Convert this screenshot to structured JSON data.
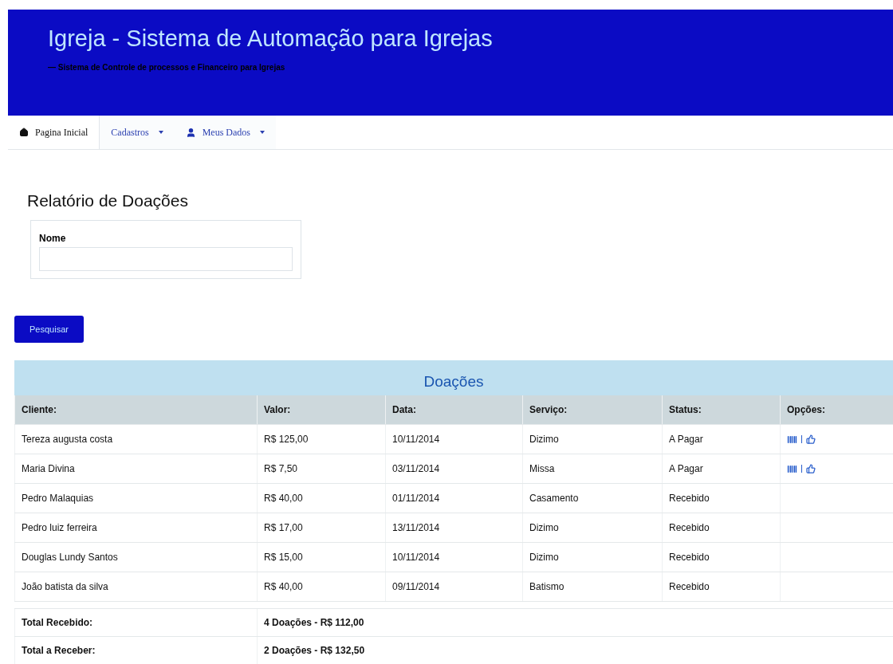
{
  "header": {
    "title": "Igreja - Sistema de Automação para Igrejas",
    "subtitle": "— Sistema de Controle de processos e Financeiro para Igrejas"
  },
  "nav": [
    {
      "label": "Pagina  Inicial",
      "kind": "home",
      "dropdown": false,
      "selected": true
    },
    {
      "label": "Cadastros",
      "kind": "plain",
      "dropdown": true,
      "selected": false
    },
    {
      "label": "Meus  Dados",
      "kind": "user",
      "dropdown": true,
      "selected": false
    }
  ],
  "page_title": "Relatório de Doações",
  "filter": {
    "label": "Nome"
  },
  "search_button": "Pesquisar",
  "table": {
    "title": "Doações",
    "columns": [
      "Cliente:",
      "Valor:",
      "Data:",
      "Serviço:",
      "Status:",
      "Opções:"
    ],
    "rows": [
      {
        "cells": [
          "Tereza augusta costa",
          "R$ 125,00",
          "10/11/2014",
          "Dizimo",
          "A Pagar"
        ],
        "actions": true
      },
      {
        "cells": [
          "Maria Divina",
          "R$ 7,50",
          "03/11/2014",
          "Missa",
          "A Pagar"
        ],
        "actions": true
      },
      {
        "cells": [
          "Pedro Malaquias",
          "R$ 40,00",
          "01/11/2014",
          "Casamento",
          "Recebido"
        ],
        "actions": false
      },
      {
        "cells": [
          "Pedro luiz ferreira",
          "R$ 17,00",
          "13/11/2014",
          "Dizimo",
          "Recebido"
        ],
        "actions": false
      },
      {
        "cells": [
          "Douglas Lundy Santos",
          "R$ 15,00",
          "10/11/2014",
          "Dizimo",
          "Recebido"
        ],
        "actions": false
      },
      {
        "cells": [
          "João batista da silva",
          "R$ 40,00",
          "09/11/2014",
          "Batismo",
          "Recebido"
        ],
        "actions": false
      }
    ]
  },
  "totals": [
    {
      "label": "Total Recebido:",
      "value": "4 Doações - R$ 112,00"
    },
    {
      "label": "Total a Receber:",
      "value": "2 Doações - R$ 132,50"
    }
  ]
}
